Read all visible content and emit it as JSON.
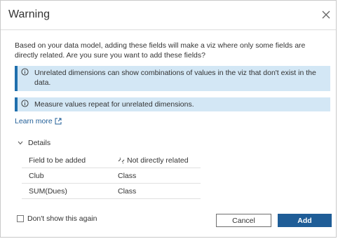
{
  "dialog": {
    "title": "Warning",
    "intro": "Based on your data model, adding these fields will make a viz where only some fields are directly related. Are you sure you want to add these fields?",
    "info_messages": [
      "Unrelated dimensions can show combinations of values in the viz that don't exist in the data.",
      "Measure values repeat for unrelated dimensions."
    ],
    "learn_more": "Learn more",
    "details_label": "Details",
    "table": {
      "headers": [
        "Field to be added",
        "Not directly related"
      ],
      "rows": [
        [
          "Club",
          "Class"
        ],
        [
          "SUM(Dues)",
          "Class"
        ]
      ]
    },
    "checkbox_label": "Don't show this again",
    "cancel_label": "Cancel",
    "add_label": "Add",
    "colors": {
      "accent": "#1f5d97",
      "info_bg": "#d3e7f5",
      "info_border": "#1f6fad"
    }
  }
}
